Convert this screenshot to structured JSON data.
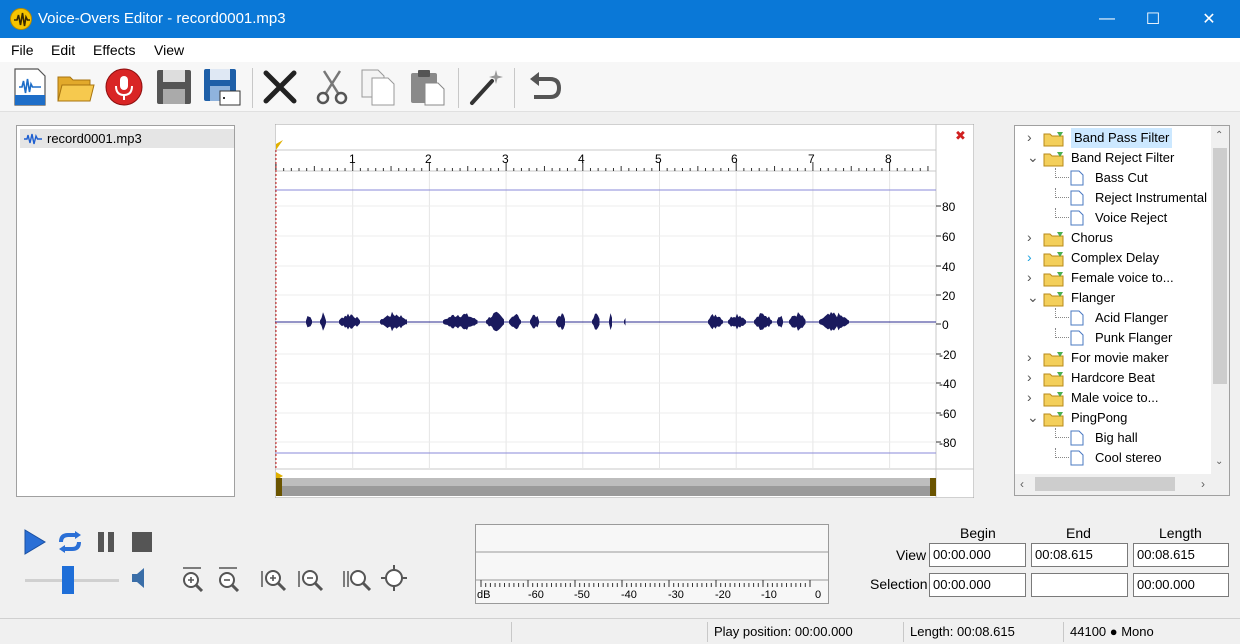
{
  "window": {
    "title": "Voice-Overs Editor - record0001.mp3",
    "minimize_glyph": "—",
    "maximize_glyph": "☐",
    "close_glyph": "✕"
  },
  "menu": [
    "File",
    "Edit",
    "Effects",
    "View"
  ],
  "toolbar": {
    "buttons": [
      "new-icon",
      "open-folder-icon",
      "record-mic-icon",
      "save-icon",
      "save-as-icon",
      "delete-icon",
      "cut-icon",
      "copy-icon",
      "paste-icon",
      "magic-wand-icon",
      "undo-icon"
    ]
  },
  "files": {
    "items": [
      {
        "name": "record0001.mp3"
      }
    ]
  },
  "waveform": {
    "close_glyph": "✖",
    "ruler_labels": [
      "1",
      "2",
      "3",
      "4",
      "5",
      "6",
      "7",
      "8"
    ],
    "db_labels": [
      "80",
      "60",
      "40",
      "20",
      "0",
      "-20",
      "-40",
      "-60",
      "-80"
    ]
  },
  "effects": {
    "items": [
      {
        "label": "Band Pass Filter",
        "level": 0,
        "state": "collapsed",
        "selected": true
      },
      {
        "label": "Band Reject Filter",
        "level": 0,
        "state": "expanded"
      },
      {
        "label": "Bass Cut",
        "level": 1,
        "state": "leaf"
      },
      {
        "label": "Reject Instrumental",
        "level": 1,
        "state": "leaf"
      },
      {
        "label": "Voice Reject",
        "level": 1,
        "state": "leaf"
      },
      {
        "label": "Chorus",
        "level": 0,
        "state": "collapsed"
      },
      {
        "label": "Complex Delay",
        "level": 0,
        "state": "collapsed-hover"
      },
      {
        "label": "Female voice to...",
        "level": 0,
        "state": "collapsed"
      },
      {
        "label": "Flanger",
        "level": 0,
        "state": "expanded"
      },
      {
        "label": "Acid Flanger",
        "level": 1,
        "state": "leaf"
      },
      {
        "label": "Punk Flanger",
        "level": 1,
        "state": "leaf"
      },
      {
        "label": "For movie maker",
        "level": 0,
        "state": "collapsed"
      },
      {
        "label": "Hardcore Beat",
        "level": 0,
        "state": "collapsed"
      },
      {
        "label": "Male voice to...",
        "level": 0,
        "state": "collapsed"
      },
      {
        "label": "PingPong",
        "level": 0,
        "state": "expanded"
      },
      {
        "label": "Big hall",
        "level": 1,
        "state": "leaf"
      },
      {
        "label": "Cool stereo",
        "level": 1,
        "state": "leaf"
      }
    ]
  },
  "transport": {
    "volume": 0.46,
    "buttons": [
      "play-icon",
      "loop-icon",
      "pause-icon",
      "stop-icon"
    ],
    "zoom_buttons": [
      "zoom-in-vertical-icon",
      "zoom-out-vertical-icon",
      "zoom-in-horizontal-icon",
      "zoom-out-horizontal-icon",
      "zoom-selection-icon",
      "zoom-fit-icon"
    ]
  },
  "meter": {
    "unit": "dB",
    "labels": [
      "-60",
      "-50",
      "-40",
      "-30",
      "-20",
      "-10",
      "0"
    ]
  },
  "position": {
    "headers": {
      "begin": "Begin",
      "end": "End",
      "length": "Length"
    },
    "rows": [
      {
        "label": "View",
        "begin": "00:00.000",
        "end": "00:08.615",
        "length": "00:08.615"
      },
      {
        "label": "Selection",
        "begin": "00:00.000",
        "end": "",
        "length": "00:00.000"
      }
    ]
  },
  "status": {
    "play_position": "Play position: 00:00.000",
    "length": "Length: 00:08.615",
    "format": "44100 ● Mono"
  }
}
